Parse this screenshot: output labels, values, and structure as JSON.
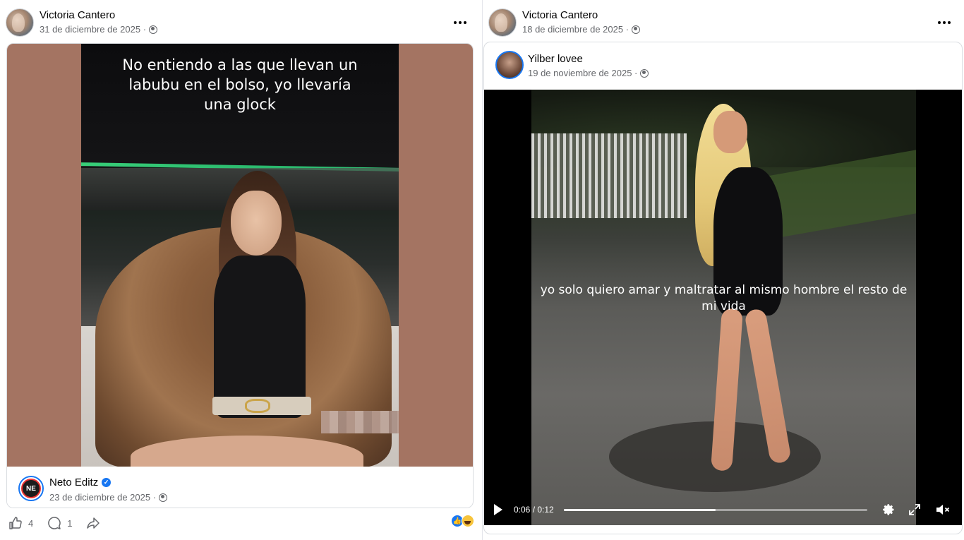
{
  "left_post": {
    "author": "Victoria Cantero",
    "date": "31 de diciembre de 2025 ·",
    "caption": "No entiendo a las que llevan un labubu en el bolso, yo llevaría una glock",
    "shared": {
      "author": "Neto Editz",
      "avatar_initials": "NE",
      "date": "23 de diciembre de 2025 ·"
    },
    "likes": "4",
    "comments": "1"
  },
  "right_post": {
    "author": "Victoria Cantero",
    "date": "18 de diciembre de 2025 ·",
    "shared": {
      "author": "Yilber lovee",
      "date": "19 de noviembre de 2025 ·"
    },
    "video": {
      "caption": "yo solo quiero amar y maltratar al mismo hombre el resto de mi vida",
      "time": "0:06 / 0:12",
      "progress": 0.5
    }
  },
  "icons": {
    "privacy": "globe-icon",
    "more": "more-icon",
    "like": "thumbs-up-icon",
    "comment": "comment-icon",
    "share": "share-icon",
    "play": "play-icon",
    "settings": "gear-icon",
    "fullscreen": "fullscreen-icon",
    "mute": "mute-icon"
  },
  "colors": {
    "brand": "#1877f2",
    "secondary_text": "#65676b",
    "left_media_bg": "#a47462"
  }
}
